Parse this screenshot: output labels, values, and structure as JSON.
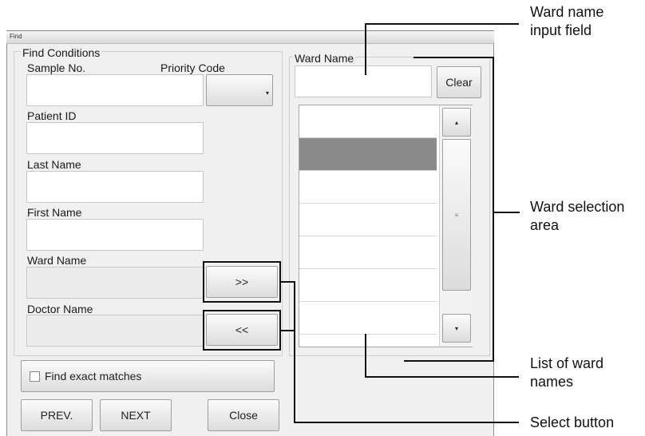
{
  "dialog": {
    "title": "Find",
    "group_title": "Find Conditions",
    "fields": {
      "sample_no": {
        "label": "Sample No.",
        "value": ""
      },
      "priority_code": {
        "label": "Priority Code",
        "value": ""
      },
      "patient_id": {
        "label": "Patient ID",
        "value": ""
      },
      "last_name": {
        "label": "Last Name",
        "value": ""
      },
      "first_name": {
        "label": "First Name",
        "value": ""
      },
      "ward_name": {
        "label": "Ward Name",
        "value": ""
      },
      "doctor_name": {
        "label": "Doctor Name",
        "value": ""
      }
    },
    "select_ward_button": ">>",
    "select_doctor_button": "<<",
    "exact_match_label": "Find exact matches",
    "exact_match_checked": false,
    "prev_button": "PREV.",
    "next_button": "NEXT",
    "close_button": "Close",
    "ward_panel": {
      "title": "Ward Name",
      "input_value": "",
      "clear_button": "Clear",
      "items": [
        "",
        "",
        "",
        "",
        "",
        "",
        ""
      ],
      "selected_index": 1
    }
  },
  "callouts": {
    "ward_input": "Ward name\ninput field",
    "ward_selection": "Ward selection\narea",
    "list_names": "List of ward\nnames",
    "select_button": "Select button"
  },
  "colors": {
    "dialog_bg": "#f0f0f0",
    "selected_row": "#8a8a8a",
    "callout_line": "#111111"
  }
}
